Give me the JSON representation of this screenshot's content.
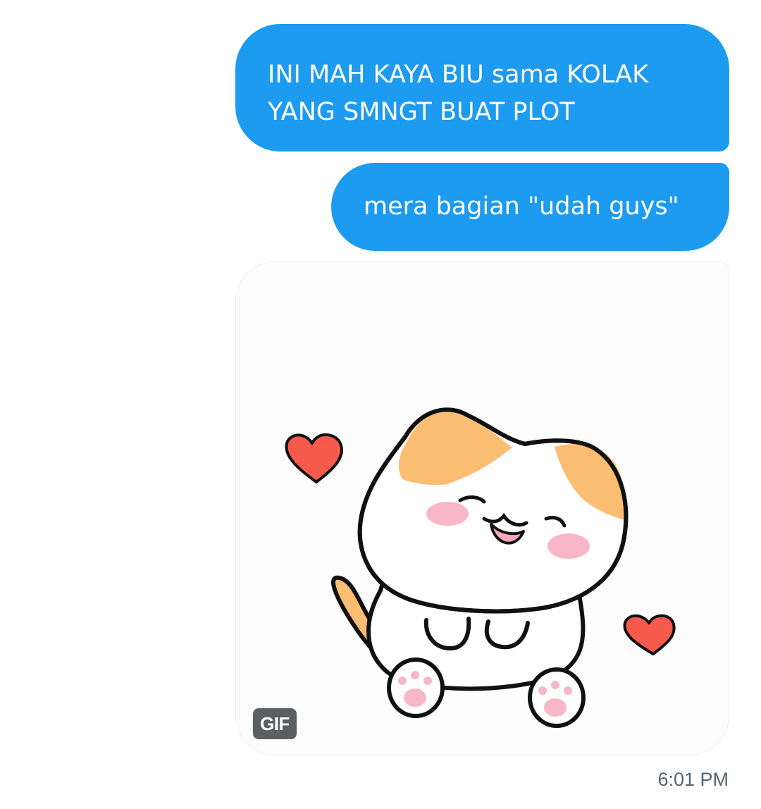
{
  "messages": [
    {
      "text_line1": "INI MAH KAYA BIU sama KOLAK",
      "text_line2": "YANG SMNGT BUAT PLOT"
    },
    {
      "text": "mera bagian \"udah guys\""
    }
  ],
  "gif": {
    "badge": "GIF",
    "content": "cat-with-hearts-sticker"
  },
  "timestamp": "6:01 PM",
  "colors": {
    "bubble": "#1d9bf0",
    "bubble_text": "#ffffff",
    "cat_patch": "#fbbd72",
    "heart": "#f65a4c",
    "blush": "#f8a9bd",
    "timestamp": "#536471"
  }
}
